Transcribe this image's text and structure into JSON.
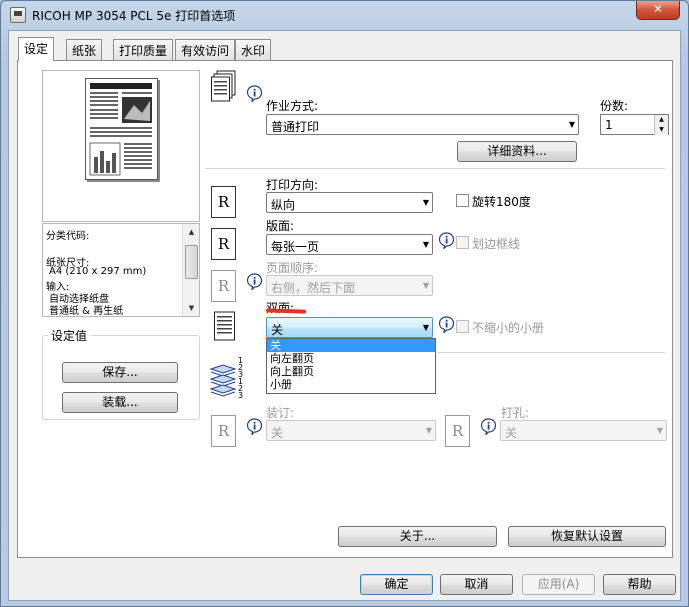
{
  "window": {
    "title": "RICOH MP 3054 PCL 5e 打印首选项",
    "close_label": "✕"
  },
  "tabs": [
    "设定",
    "纸张",
    "打印质量",
    "有效访问",
    "水印"
  ],
  "info_box": {
    "lines": [
      "分类代码:",
      "纸张尺寸:",
      "A4 (210 x 297 mm)",
      "输入:",
      "自动选择纸盘",
      "普通纸 & 再生纸"
    ]
  },
  "preset_group": {
    "title": "设定值",
    "save_label": "保存...",
    "load_label": "装载..."
  },
  "job": {
    "label": "作业方式:",
    "value": "普通打印",
    "details_label": "详细资料..."
  },
  "copies": {
    "label": "份数:",
    "value": "1"
  },
  "orientation": {
    "label": "打印方向:",
    "value": "纵向",
    "rotate_label": "旋转180度"
  },
  "layout": {
    "label": "版面:",
    "value": "每张一页",
    "border_label": "划边框线"
  },
  "page_order": {
    "label": "页面顺序:",
    "value": "右侧，然后下面"
  },
  "duplex": {
    "label": "双面:",
    "value": "关",
    "no_reduce_label": "不缩小的小册",
    "options": [
      "关",
      "向左翻页",
      "向上翻页",
      "小册"
    ]
  },
  "staple": {
    "label": "装订:",
    "value": "关"
  },
  "punch": {
    "label": "打孔:",
    "value": "关"
  },
  "bottom_buttons": {
    "about_label": "关于...",
    "restore_label": "恢复默认设置"
  },
  "dialog_buttons": {
    "ok": "确定",
    "cancel": "取消",
    "apply": "应用(A)",
    "help": "帮助"
  },
  "glyphs": {
    "r_letter": "R",
    "dropdown_arrow": "▼",
    "spin_up": "▲",
    "spin_down": "▼",
    "scroll_up": "▲",
    "scroll_down": "▼",
    "booklet_numbers": "1 2 3 1 2 3"
  },
  "colors": {
    "selection": "#3399ff",
    "red_annotation": "#e4312b",
    "close_button": "#c8452a"
  }
}
